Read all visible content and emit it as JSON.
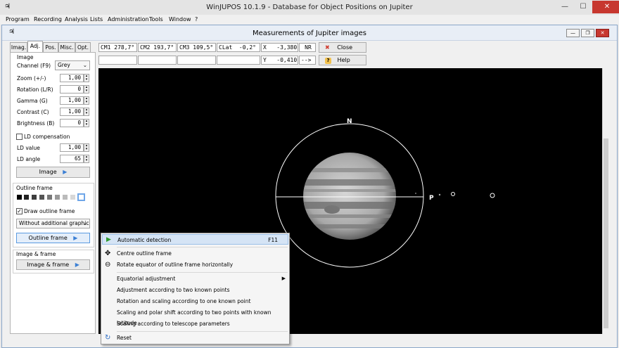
{
  "app": {
    "title": "WinJUPOS 10.1.9 - Database for Object Positions on Jupiter"
  },
  "menu": [
    "Program",
    "Recording",
    "Analysis",
    "Lists",
    "Administration",
    "Tools",
    "Window",
    "?"
  ],
  "child": {
    "title": "Measurements of Jupiter images"
  },
  "tabs": [
    "Imag.",
    "Adj.",
    "Pos.",
    "Misc.",
    "Opt."
  ],
  "panel": {
    "image_heading": "Image",
    "channel_label": "Channel (F9)",
    "channel_value": "Grey",
    "zoom_label": "Zoom (+/-)",
    "zoom_value": "1,00",
    "rotation_label": "Rotation (L/R)",
    "rotation_value": "0",
    "gamma_label": "Gamma (G)",
    "gamma_value": "1,00",
    "contrast_label": "Contrast (C)",
    "contrast_value": "1,00",
    "brightness_label": "Brightness (B)",
    "brightness_value": "0",
    "ld_comp_label": "LD compensation",
    "ld_value_label": "LD value",
    "ld_value": "1,00",
    "ld_angle_label": "LD angle",
    "ld_angle": "65",
    "image_button": "Image",
    "outline_heading": "Outline frame",
    "draw_outline_label": "Draw outline frame",
    "graphic_select": "Without additional graphic",
    "outline_button": "Outline frame",
    "image_frame_heading": "Image & frame",
    "image_frame_button": "Image & frame"
  },
  "readouts": {
    "cm1": "CM1 278,7°",
    "cm2": "CM2 193,7°",
    "cm3": "CM3 109,5°",
    "clat": "CLat  -0,2°",
    "x": "X   -3,380",
    "nr": "NR",
    "y": "Y   -0,410",
    "arrow": "-->"
  },
  "buttons": {
    "close": "Close",
    "help": "Help"
  },
  "image": {
    "north": "N",
    "pole": "P"
  },
  "context_menu": {
    "items": [
      {
        "label": "Automatic detection",
        "shortcut": "F11"
      },
      {
        "label": "Centre outline frame"
      },
      {
        "label": "Rotate equator of outline frame horizontally"
      },
      {
        "label": "Equatorial adjustment"
      },
      {
        "label": "Adjustment according to two known points"
      },
      {
        "label": "Rotation and scaling according to one known point"
      },
      {
        "label": "Scaling and polar shift according to two points with known latitude"
      },
      {
        "label": "Scaling according to telescope parameters"
      },
      {
        "label": "Reset"
      }
    ]
  }
}
